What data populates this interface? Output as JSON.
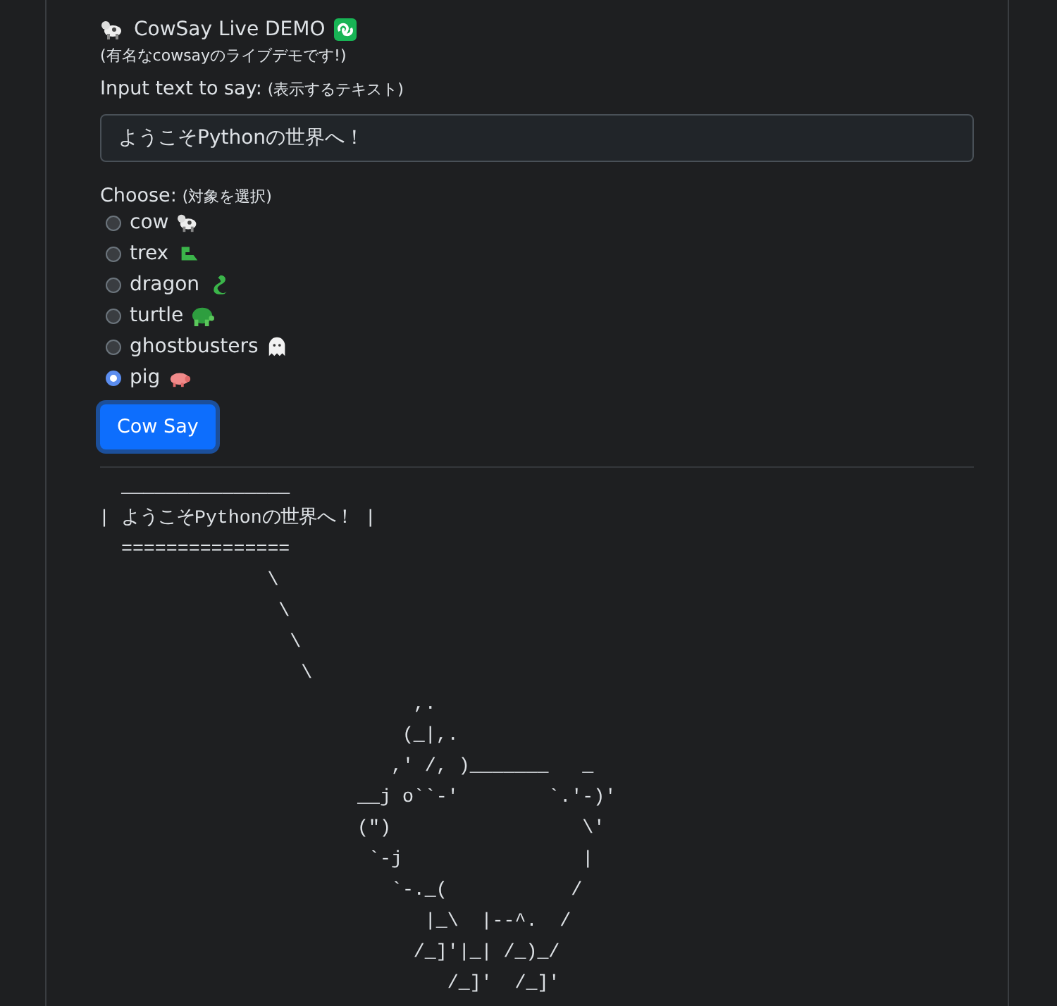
{
  "header": {
    "title": "CowSay Live DEMO",
    "subtitle": "(有名なcowsayのライブデモです!)"
  },
  "input": {
    "label": "Input text to say:",
    "hint": "(表示するテキスト)",
    "value": "ようこそPythonの世界へ！"
  },
  "choose": {
    "label": "Choose:",
    "hint": "(対象を選択)",
    "options": [
      {
        "label": "cow",
        "kind": "cow",
        "selected": false
      },
      {
        "label": "trex",
        "kind": "trex",
        "selected": false
      },
      {
        "label": "dragon",
        "kind": "dragon",
        "selected": false
      },
      {
        "label": "turtle",
        "kind": "turtle",
        "selected": false
      },
      {
        "label": "ghostbusters",
        "kind": "ghost",
        "selected": false
      },
      {
        "label": "pig",
        "kind": "pig",
        "selected": true
      }
    ]
  },
  "button": "Cow Say",
  "output": [
    "  _______________",
    "| ようこそPythonの世界へ！ |",
    "  ===============",
    "               \\",
    "                \\",
    "                 \\",
    "                  \\",
    "                            ,.",
    "                           (_|,.",
    "                          ,' /, )_______   _",
    "                       __j o``-'        `.'-)'",
    "                       (\")                 \\'",
    "                        `-j                |",
    "                          `-._(           /",
    "                             |_\\  |--^.  /",
    "                            /_]'|_| /_)_/",
    "                               /_]'  /_]'"
  ]
}
